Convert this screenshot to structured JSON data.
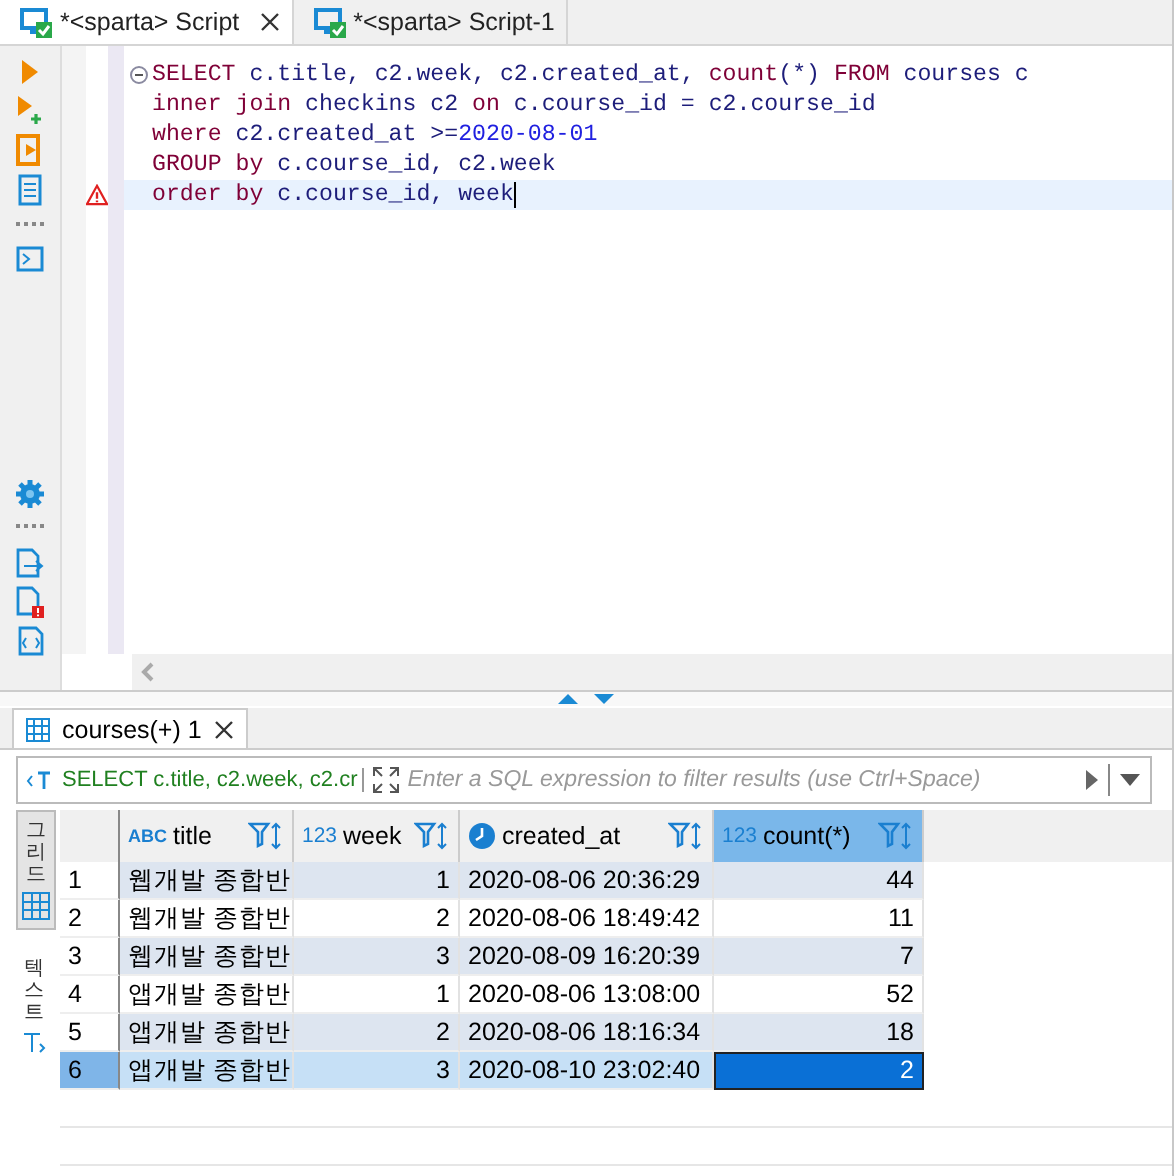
{
  "editor_tabs": [
    {
      "label": "*<sparta> Script",
      "selected": true,
      "closable": true
    },
    {
      "label": "*<sparta> Script-1",
      "selected": false,
      "closable": false
    }
  ],
  "code_lines": [
    {
      "current": false,
      "warning": false,
      "folding": true,
      "tokens": [
        {
          "kind": "keyword",
          "text": "SELECT"
        },
        {
          "kind": "text",
          "text": " c.title, c2.week, c2.created_at, "
        },
        {
          "kind": "keyword",
          "text": "count"
        },
        {
          "kind": "text",
          "text": "(*) "
        },
        {
          "kind": "keyword",
          "text": "FROM"
        },
        {
          "kind": "text",
          "text": " courses c"
        }
      ]
    },
    {
      "current": false,
      "warning": false,
      "folding": false,
      "tokens": [
        {
          "kind": "keyword",
          "text": "inner "
        },
        {
          "kind": "keyword",
          "text": "join"
        },
        {
          "kind": "text",
          "text": " checkins c2 "
        },
        {
          "kind": "keyword",
          "text": "on"
        },
        {
          "kind": "text",
          "text": " c.course_id = c2.course_id"
        }
      ]
    },
    {
      "current": false,
      "warning": false,
      "folding": false,
      "tokens": [
        {
          "kind": "keyword",
          "text": "where"
        },
        {
          "kind": "text",
          "text": " c2.created_at >="
        },
        {
          "kind": "literal",
          "text": "2020-08-01"
        }
      ]
    },
    {
      "current": false,
      "warning": false,
      "folding": false,
      "tokens": [
        {
          "kind": "keyword",
          "text": "GROUP "
        },
        {
          "kind": "keyword",
          "text": "by"
        },
        {
          "kind": "text",
          "text": " c.course_id, c2.week"
        }
      ]
    },
    {
      "current": true,
      "warning": true,
      "folding": false,
      "tokens": [
        {
          "kind": "keyword",
          "text": "order "
        },
        {
          "kind": "keyword",
          "text": "by"
        },
        {
          "kind": "text",
          "text": " c.course_id, week"
        }
      ]
    }
  ],
  "result_tabs": [
    {
      "label": "courses(+) 1",
      "selected": true
    }
  ],
  "filter": {
    "query": "SELECT c.title, c2.week, c2.cr",
    "placeholder": "Enter a SQL expression to filter results (use Ctrl+Space)"
  },
  "side_tabs": [
    {
      "label": "그리드",
      "selected": true
    },
    {
      "label": "텍스트",
      "selected": false
    }
  ],
  "columns": [
    {
      "label": "title",
      "kind": "text",
      "type_label": "ABC",
      "selected": false
    },
    {
      "label": "week",
      "kind": "number",
      "type_label": "123",
      "selected": false
    },
    {
      "label": "created_at",
      "kind": "datetime",
      "selected": false
    },
    {
      "label": "count(*)",
      "kind": "number",
      "type_label": "123",
      "selected": true
    }
  ],
  "rows": [
    {
      "number": "1",
      "selected": false,
      "cells": [
        {
          "text": "웹개발 종합반",
          "selected": false
        },
        {
          "text": "1",
          "selected": false
        },
        {
          "text": "2020-08-06 20:36:29",
          "selected": false
        },
        {
          "text": "44",
          "selected": false
        }
      ]
    },
    {
      "number": "2",
      "selected": false,
      "cells": [
        {
          "text": "웹개발 종합반",
          "selected": false
        },
        {
          "text": "2",
          "selected": false
        },
        {
          "text": "2020-08-06 18:49:42",
          "selected": false
        },
        {
          "text": "11",
          "selected": false
        }
      ]
    },
    {
      "number": "3",
      "selected": false,
      "cells": [
        {
          "text": "웹개발 종합반",
          "selected": false
        },
        {
          "text": "3",
          "selected": false
        },
        {
          "text": "2020-08-09 16:20:39",
          "selected": false
        },
        {
          "text": "7",
          "selected": false
        }
      ]
    },
    {
      "number": "4",
      "selected": false,
      "cells": [
        {
          "text": "앱개발 종합반",
          "selected": false
        },
        {
          "text": "1",
          "selected": false
        },
        {
          "text": "2020-08-06 13:08:00",
          "selected": false
        },
        {
          "text": "52",
          "selected": false
        }
      ]
    },
    {
      "number": "5",
      "selected": false,
      "cells": [
        {
          "text": "앱개발 종합반",
          "selected": false
        },
        {
          "text": "2",
          "selected": false
        },
        {
          "text": "2020-08-06 18:16:34",
          "selected": false
        },
        {
          "text": "18",
          "selected": false
        }
      ]
    },
    {
      "number": "6",
      "selected": true,
      "cells": [
        {
          "text": "앱개발 종합반",
          "selected": false
        },
        {
          "text": "3",
          "selected": false
        },
        {
          "text": "2020-08-10 23:02:40",
          "selected": false
        },
        {
          "text": "2",
          "selected": true
        }
      ]
    }
  ]
}
